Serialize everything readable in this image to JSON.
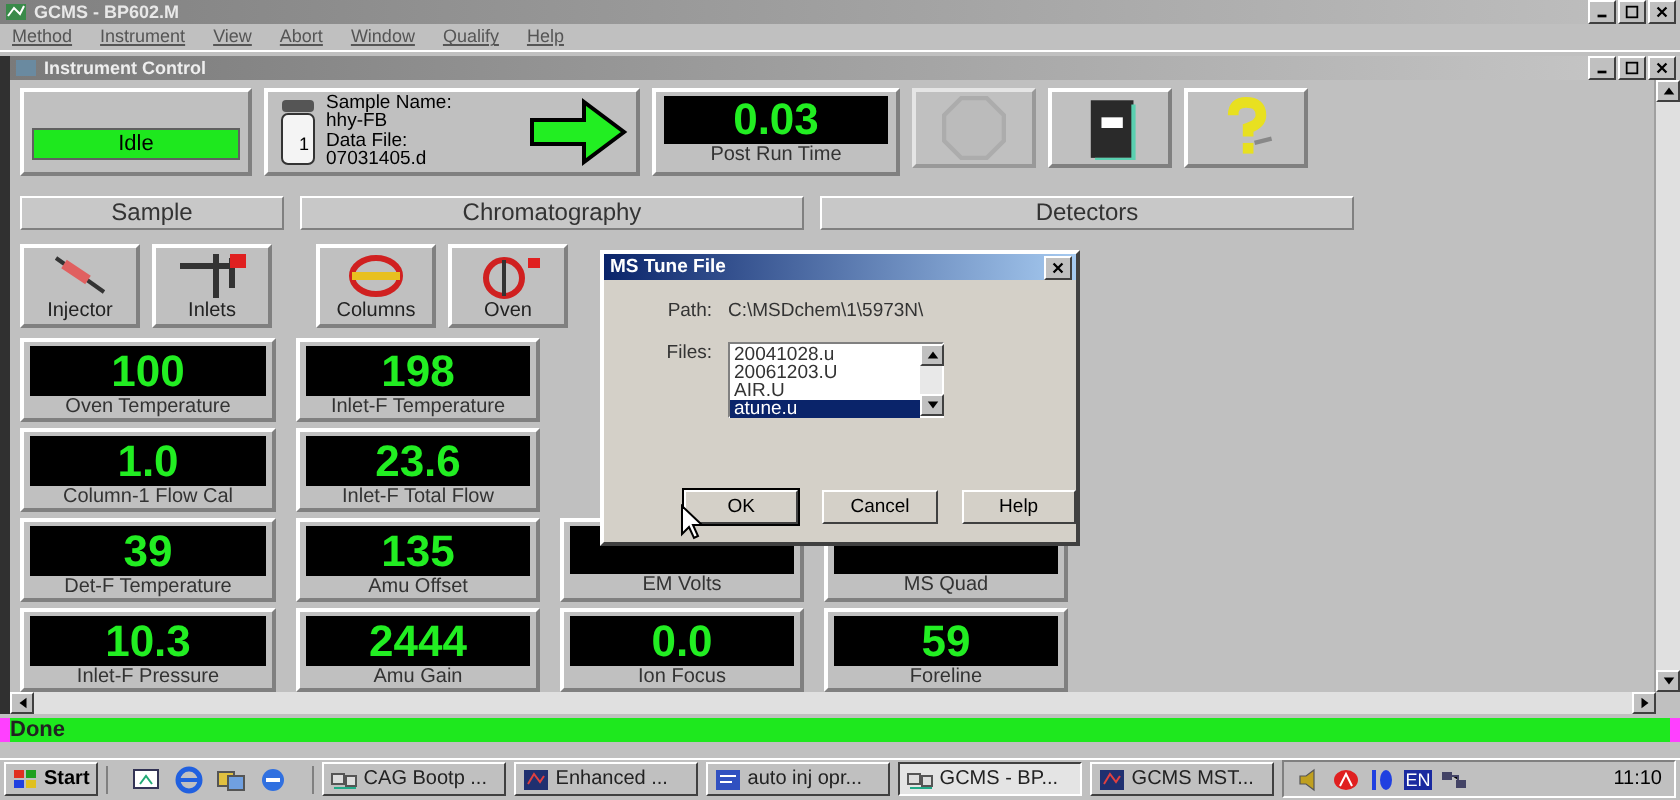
{
  "window": {
    "title": "GCMS - BP602.M"
  },
  "menu": [
    "Method",
    "Instrument",
    "View",
    "Abort",
    "Window",
    "Qualify",
    "Help"
  ],
  "child_window": {
    "title": "Instrument Control"
  },
  "status_panel": {
    "state": "Idle"
  },
  "sample_panel": {
    "vial": "1",
    "lines": [
      "Sample Name:",
      "hhy-FB",
      "Data File:",
      "07031405.d"
    ]
  },
  "post_run": {
    "value": "0.03",
    "label": "Post Run Time"
  },
  "toolbar_buttons": [
    {
      "kind": "stop",
      "disabled": true
    },
    {
      "kind": "notebook",
      "disabled": false
    },
    {
      "kind": "help",
      "disabled": false
    }
  ],
  "sections": [
    "Sample",
    "Chromatography",
    "Detectors"
  ],
  "device_buttons": [
    {
      "kind": "injector",
      "label": "Injector"
    },
    {
      "kind": "inlets",
      "label": "Inlets"
    },
    {
      "kind": "columns",
      "label": "Columns"
    },
    {
      "kind": "oven",
      "label": "Oven"
    }
  ],
  "meters": [
    [
      {
        "value": "100",
        "label": "Oven Temperature"
      },
      {
        "value": "198",
        "label": "Inlet-F Temperature"
      }
    ],
    [
      {
        "value": "1.0",
        "label": "Column-1 Flow Cal"
      },
      {
        "value": "23.6",
        "label": "Inlet-F Total Flow"
      }
    ],
    [
      {
        "value": "39",
        "label": "Det-F Temperature"
      },
      {
        "value": "135",
        "label": "Amu Offset"
      },
      {
        "label": "EM Volts"
      },
      {
        "label": "MS Quad"
      }
    ],
    [
      {
        "value": "10.3",
        "label": "Inlet-F Pressure"
      },
      {
        "value": "2444",
        "label": "Amu Gain"
      },
      {
        "value": "0.0",
        "label": "Ion Focus"
      },
      {
        "value": "59",
        "label": "Foreline"
      }
    ]
  ],
  "dialog": {
    "title": "MS Tune File",
    "path_label": "Path:",
    "path": "C:\\MSDchem\\1\\5973N\\",
    "files_label": "Files:",
    "files": [
      {
        "name": "20041028.u",
        "selected": false
      },
      {
        "name": "20061203.U",
        "selected": false
      },
      {
        "name": "AIR.U",
        "selected": false
      },
      {
        "name": "atune.u",
        "selected": true
      }
    ],
    "buttons": [
      {
        "label": "OK",
        "focused": true
      },
      {
        "label": "Cancel",
        "focused": false
      },
      {
        "label": "Help",
        "focused": false
      }
    ]
  },
  "status_bar": {
    "text": "Done"
  },
  "taskbar": {
    "start": "Start",
    "tasks": [
      {
        "kind": "network",
        "label": "CAG Bootp ...",
        "selected": false
      },
      {
        "kind": "app",
        "label": "Enhanced ...",
        "selected": false
      },
      {
        "kind": "doc",
        "label": "auto inj opr...",
        "selected": false
      },
      {
        "kind": "network",
        "label": "GCMS - BP...",
        "selected": true
      },
      {
        "kind": "app",
        "label": "GCMS MST...",
        "selected": false
      }
    ],
    "language": "EN",
    "time": "11:10"
  }
}
